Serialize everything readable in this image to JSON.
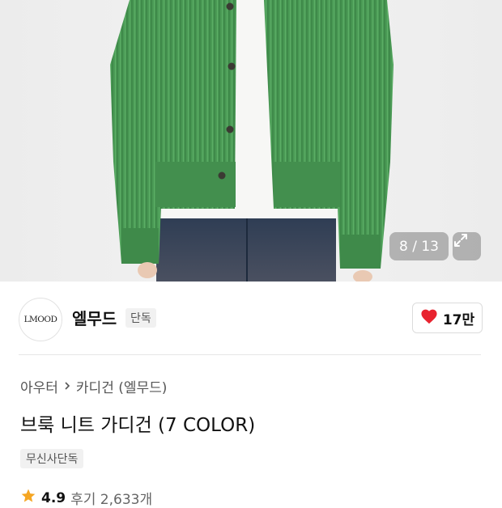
{
  "gallery": {
    "counter": "8 / 13"
  },
  "brand": {
    "logo_text": "LMOOD",
    "name": "엘무드",
    "badge": "단독",
    "likes": "17만"
  },
  "product": {
    "breadcrumb": [
      "아우터",
      "카디건 (엘무드)"
    ],
    "title": "브룩 니트 가디건 (7 COLOR)",
    "tag": "무신사단독",
    "rating": "4.9",
    "reviews": "후기 2,633개"
  },
  "colors": {
    "like_heart": "#e8232f",
    "star": "#f5a623",
    "cardigan": "#4a9a55"
  },
  "icons": [
    "expand-icon",
    "heart-icon",
    "chevron-right-icon",
    "star-icon"
  ]
}
